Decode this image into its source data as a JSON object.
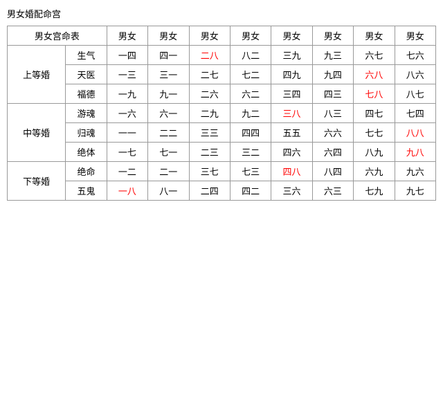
{
  "title": "男女婚配命宫",
  "table": {
    "header": {
      "col0": "男女宫命表",
      "cols": [
        "男女",
        "男女",
        "男女",
        "男女",
        "男女",
        "男女",
        "男女",
        "男女"
      ]
    },
    "sections": [
      {
        "category": "上等婚",
        "rows": [
          {
            "sub": "生气",
            "cells": [
              {
                "text": "一四",
                "red": false
              },
              {
                "text": "四一",
                "red": false
              },
              {
                "text": "二八",
                "red": true
              },
              {
                "text": "八二",
                "red": false
              },
              {
                "text": "三九",
                "red": false
              },
              {
                "text": "九三",
                "red": false
              },
              {
                "text": "六七",
                "red": false
              },
              {
                "text": "七六",
                "red": false
              }
            ]
          },
          {
            "sub": "天医",
            "cells": [
              {
                "text": "一三",
                "red": false
              },
              {
                "text": "三一",
                "red": false
              },
              {
                "text": "二七",
                "red": false
              },
              {
                "text": "七二",
                "red": false
              },
              {
                "text": "四九",
                "red": false
              },
              {
                "text": "九四",
                "red": false
              },
              {
                "text": "六八",
                "red": true
              },
              {
                "text": "八六",
                "red": false
              }
            ]
          },
          {
            "sub": "福德",
            "cells": [
              {
                "text": "一九",
                "red": false
              },
              {
                "text": "九一",
                "red": false
              },
              {
                "text": "二六",
                "red": false
              },
              {
                "text": "六二",
                "red": false
              },
              {
                "text": "三四",
                "red": false
              },
              {
                "text": "四三",
                "red": false
              },
              {
                "text": "七八",
                "red": true
              },
              {
                "text": "八七",
                "red": false
              }
            ]
          }
        ]
      },
      {
        "category": "中等婚",
        "rows": [
          {
            "sub": "游魂",
            "cells": [
              {
                "text": "一六",
                "red": false
              },
              {
                "text": "六一",
                "red": false
              },
              {
                "text": "二九",
                "red": false
              },
              {
                "text": "九二",
                "red": false
              },
              {
                "text": "三八",
                "red": true
              },
              {
                "text": "八三",
                "red": false
              },
              {
                "text": "四七",
                "red": false
              },
              {
                "text": "七四",
                "red": false
              }
            ]
          },
          {
            "sub": "归魂",
            "cells": [
              {
                "text": "一一",
                "red": false
              },
              {
                "text": "二二",
                "red": false
              },
              {
                "text": "三三",
                "red": false
              },
              {
                "text": "四四",
                "red": false
              },
              {
                "text": "五五",
                "red": false
              },
              {
                "text": "六六",
                "red": false
              },
              {
                "text": "七七",
                "red": false
              },
              {
                "text": "八八",
                "red": true
              }
            ]
          },
          {
            "sub": "绝体",
            "cells": [
              {
                "text": "一七",
                "red": false
              },
              {
                "text": "七一",
                "red": false
              },
              {
                "text": "二三",
                "red": false
              },
              {
                "text": "三二",
                "red": false
              },
              {
                "text": "四六",
                "red": false
              },
              {
                "text": "六四",
                "red": false
              },
              {
                "text": "八九",
                "red": false
              },
              {
                "text": "九八",
                "red": true
              }
            ]
          }
        ]
      },
      {
        "category": "下等婚",
        "rows": [
          {
            "sub": "绝命",
            "cells": [
              {
                "text": "一二",
                "red": false
              },
              {
                "text": "二一",
                "red": false
              },
              {
                "text": "三七",
                "red": false
              },
              {
                "text": "七三",
                "red": false
              },
              {
                "text": "四八",
                "red": true
              },
              {
                "text": "八四",
                "red": false
              },
              {
                "text": "六九",
                "red": false
              },
              {
                "text": "九六",
                "red": false
              }
            ]
          },
          {
            "sub": "五鬼",
            "cells": [
              {
                "text": "一八",
                "red": true
              },
              {
                "text": "八一",
                "red": false
              },
              {
                "text": "二四",
                "red": false
              },
              {
                "text": "四二",
                "red": false
              },
              {
                "text": "三六",
                "red": false
              },
              {
                "text": "六三",
                "red": false
              },
              {
                "text": "七九",
                "red": false
              },
              {
                "text": "九七",
                "red": false
              }
            ]
          }
        ]
      }
    ]
  }
}
